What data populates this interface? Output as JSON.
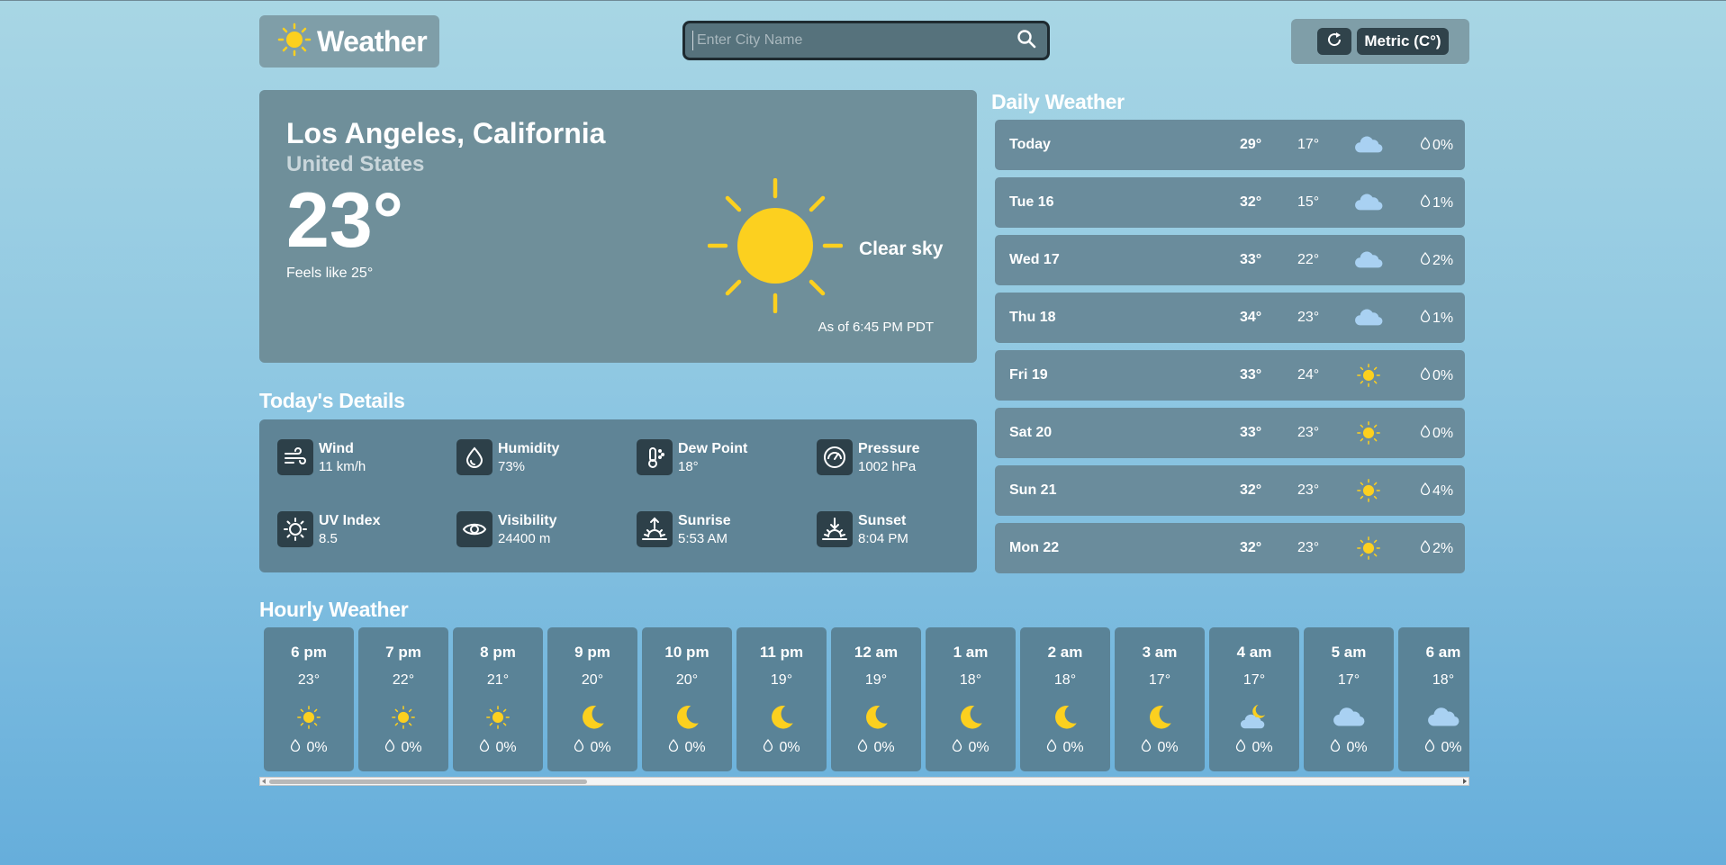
{
  "header": {
    "app_title": "Weather",
    "search_placeholder": "Enter City Name",
    "units_label": "Metric (C°)"
  },
  "current": {
    "city": "Los Angeles, California",
    "country": "United States",
    "temperature": "23°",
    "feels_like": "Feels like 25°",
    "condition": "Clear sky",
    "as_of": "As of 6:45 PM PDT",
    "icon": "sun-icon"
  },
  "details": {
    "title": "Today's Details",
    "items": [
      {
        "label": "Wind",
        "value": "11 km/h",
        "icon": "wind-icon"
      },
      {
        "label": "Humidity",
        "value": "73%",
        "icon": "droplet-icon"
      },
      {
        "label": "Dew Point",
        "value": "18°",
        "icon": "thermometer-icon"
      },
      {
        "label": "Pressure",
        "value": "1002 hPa",
        "icon": "gauge-icon"
      },
      {
        "label": "UV Index",
        "value": "8.5",
        "icon": "uv-sun-icon"
      },
      {
        "label": "Visibility",
        "value": "24400 m",
        "icon": "eye-icon"
      },
      {
        "label": "Sunrise",
        "value": "5:53 AM",
        "icon": "sunrise-icon"
      },
      {
        "label": "Sunset",
        "value": "8:04 PM",
        "icon": "sunset-icon"
      }
    ]
  },
  "daily": {
    "title": "Daily Weather",
    "days": [
      {
        "day": "Today",
        "high": "29°",
        "low": "17°",
        "icon": "cloud",
        "pop": "0%"
      },
      {
        "day": "Tue 16",
        "high": "32°",
        "low": "15°",
        "icon": "cloud",
        "pop": "1%"
      },
      {
        "day": "Wed 17",
        "high": "33°",
        "low": "22°",
        "icon": "cloud",
        "pop": "2%"
      },
      {
        "day": "Thu 18",
        "high": "34°",
        "low": "23°",
        "icon": "cloud",
        "pop": "1%"
      },
      {
        "day": "Fri 19",
        "high": "33°",
        "low": "24°",
        "icon": "sun",
        "pop": "0%"
      },
      {
        "day": "Sat 20",
        "high": "33°",
        "low": "23°",
        "icon": "sun",
        "pop": "0%"
      },
      {
        "day": "Sun 21",
        "high": "32°",
        "low": "23°",
        "icon": "sun",
        "pop": "4%"
      },
      {
        "day": "Mon 22",
        "high": "32°",
        "low": "23°",
        "icon": "sun",
        "pop": "2%"
      }
    ]
  },
  "hourly": {
    "title": "Hourly Weather",
    "hours": [
      {
        "time": "6 pm",
        "temp": "23°",
        "icon": "sun",
        "pop": "0%"
      },
      {
        "time": "7 pm",
        "temp": "22°",
        "icon": "sun",
        "pop": "0%"
      },
      {
        "time": "8 pm",
        "temp": "21°",
        "icon": "sun",
        "pop": "0%"
      },
      {
        "time": "9 pm",
        "temp": "20°",
        "icon": "moon",
        "pop": "0%"
      },
      {
        "time": "10 pm",
        "temp": "20°",
        "icon": "moon",
        "pop": "0%"
      },
      {
        "time": "11 pm",
        "temp": "19°",
        "icon": "moon",
        "pop": "0%"
      },
      {
        "time": "12 am",
        "temp": "19°",
        "icon": "moon",
        "pop": "0%"
      },
      {
        "time": "1 am",
        "temp": "18°",
        "icon": "moon",
        "pop": "0%"
      },
      {
        "time": "2 am",
        "temp": "18°",
        "icon": "moon",
        "pop": "0%"
      },
      {
        "time": "3 am",
        "temp": "17°",
        "icon": "moon",
        "pop": "0%"
      },
      {
        "time": "4 am",
        "temp": "17°",
        "icon": "moon-cloud",
        "pop": "0%"
      },
      {
        "time": "5 am",
        "temp": "17°",
        "icon": "cloud",
        "pop": "0%"
      },
      {
        "time": "6 am",
        "temp": "18°",
        "icon": "cloud",
        "pop": "0%"
      }
    ]
  },
  "colors": {
    "sun": "#fcd01f",
    "cloud": "#a9d1f2",
    "card": "#6a8c9c",
    "icon_box": "#2d4049"
  }
}
